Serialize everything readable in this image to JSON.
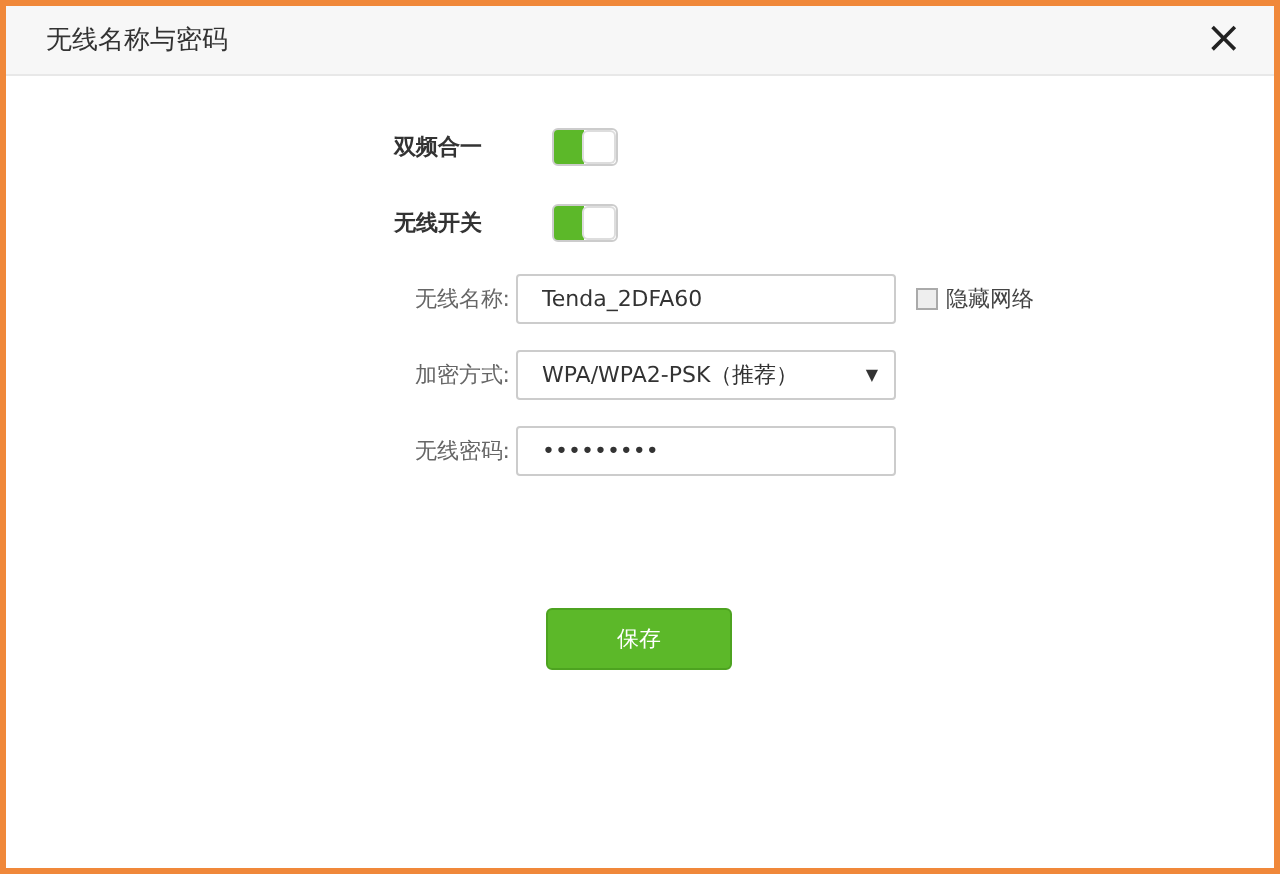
{
  "dialog": {
    "title": "无线名称与密码",
    "close": "×"
  },
  "rows": [
    {
      "kind": "toggle",
      "label": "双频合一",
      "on": true
    },
    {
      "kind": "toggle",
      "label": "无线开关",
      "on": true
    },
    {
      "kind": "text",
      "label": "无线名称:",
      "value": "Tenda_2DFA60",
      "checkbox": {
        "label": "隐藏网络",
        "checked": false
      }
    },
    {
      "kind": "select",
      "label": "加密方式:",
      "value": "WPA/WPA2-PSK（推荐）",
      "caret": "▼"
    },
    {
      "kind": "text",
      "label": "无线密码:",
      "value": "•••••••••"
    }
  ],
  "save_button": "保存"
}
